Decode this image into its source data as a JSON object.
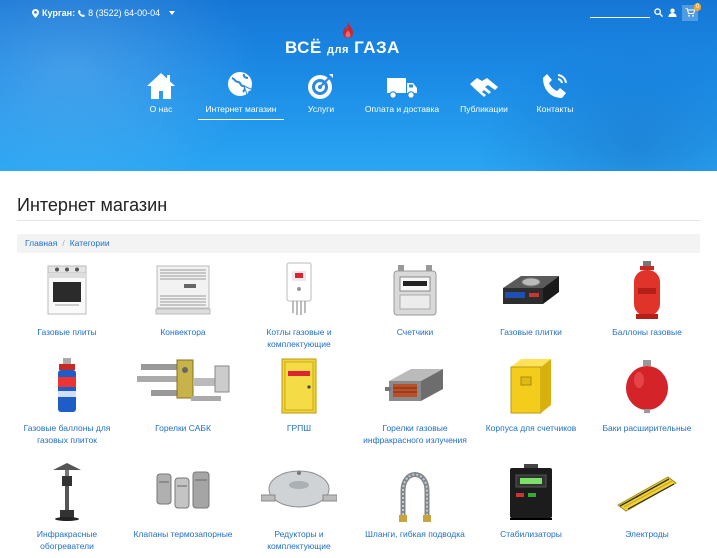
{
  "header": {
    "city": "Курган:",
    "phone": "8 (3522) 64-00-04",
    "cart_count": "0",
    "logo_text_1": "ВСЁ",
    "logo_text_2": "для",
    "logo_text_3": "ГАЗА"
  },
  "nav": {
    "items": [
      {
        "label": "О нас",
        "icon": "house-icon"
      },
      {
        "label": "Интернет магазин",
        "icon": "globe-cursor-icon"
      },
      {
        "label": "Услуги",
        "icon": "target-icon"
      },
      {
        "label": "Оплата и доставка",
        "icon": "truck-icon"
      },
      {
        "label": "Публикации",
        "icon": "handshake-icon"
      },
      {
        "label": "Контакты",
        "icon": "phone-icon"
      }
    ],
    "active": "Интернет магазин"
  },
  "page": {
    "title": "Интернет магазин",
    "breadcrumb": [
      "Главная",
      "Категории"
    ]
  },
  "categories": [
    {
      "name": "Газовые плиты",
      "icon": "stove-icon"
    },
    {
      "name": "Конвектора",
      "icon": "convector-icon"
    },
    {
      "name": "Котлы газовые и комплектующие",
      "icon": "boiler-icon"
    },
    {
      "name": "Счетчики",
      "icon": "gas-meter-icon"
    },
    {
      "name": "Газовые плитки",
      "icon": "portable-stove-icon"
    },
    {
      "name": "Баллоны газовые",
      "icon": "gas-cylinder-icon"
    },
    {
      "name": "Газовые баллоны для газовых плиток",
      "icon": "gas-can-icon"
    },
    {
      "name": "Горелки САБК",
      "icon": "burner-icon"
    },
    {
      "name": "ГРПШ",
      "icon": "cabinet-icon"
    },
    {
      "name": "Горелки газовые инфракрасного излучения",
      "icon": "infrared-burner-icon"
    },
    {
      "name": "Корпуса для счетчиков",
      "icon": "meter-box-icon"
    },
    {
      "name": "Баки расширительные",
      "icon": "expansion-tank-icon"
    },
    {
      "name": "Инфракрасные обогреватели",
      "icon": "patio-heater-icon"
    },
    {
      "name": "Клапаны термозапорные",
      "icon": "valve-icon"
    },
    {
      "name": "Редукторы и комплектующие",
      "icon": "regulator-icon"
    },
    {
      "name": "Шланги, гибкая подводка",
      "icon": "hose-icon"
    },
    {
      "name": "Стабилизаторы",
      "icon": "stabilizer-icon"
    },
    {
      "name": "Электроды",
      "icon": "electrodes-icon"
    }
  ]
}
